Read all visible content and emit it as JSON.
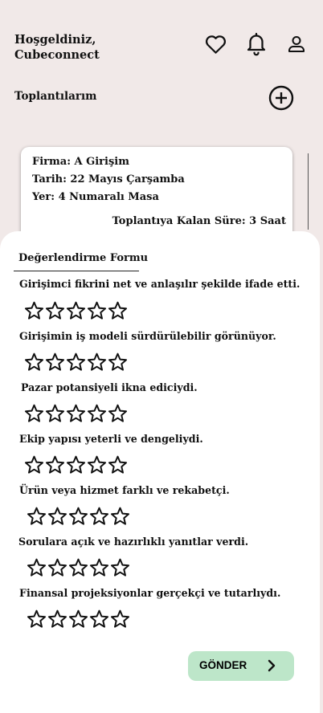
{
  "header": {
    "greeting": "Hoşgeldiniz,",
    "username": "Cubeconnect"
  },
  "icons": {
    "favorites": "heart-icon",
    "notifications": "bell-icon",
    "profile": "user-icon",
    "add": "plus-circle-icon",
    "next": "chevron-right-icon",
    "rating": "star-outline-icon"
  },
  "meetings": {
    "title": "Toplantılarım"
  },
  "card": {
    "company": "Firma: A Girişim",
    "date": "Tarih: 22 Mayıs Çarşamba",
    "place": "Yer: 4 Numaralı Masa",
    "remaining": "Toplantıya Kalan Süre: 3 Saat"
  },
  "form": {
    "title": "Değerlendirme Formu",
    "questions": [
      {
        "text": "Girişimci fikrini net ve anlaşılır şekilde ifade etti.",
        "rating": 0
      },
      {
        "text": "Girişimin iş modeli sürdürülebilir görünüyor.",
        "rating": 0
      },
      {
        "text": "Pazar potansiyeli ikna ediciydi.",
        "rating": 0
      },
      {
        "text": "Ekip yapısı yeterli ve dengeliydi.",
        "rating": 0
      },
      {
        "text": "Ürün veya hizmet farklı ve rekabetçi.",
        "rating": 0
      },
      {
        "text": "Sorulara açık ve hazırlıklı yanıtlar verdi.",
        "rating": 0
      },
      {
        "text": "Finansal projeksiyonlar gerçekçi ve tutarlıydı.",
        "rating": 0
      }
    ],
    "submit_label": "GÖNDER"
  }
}
